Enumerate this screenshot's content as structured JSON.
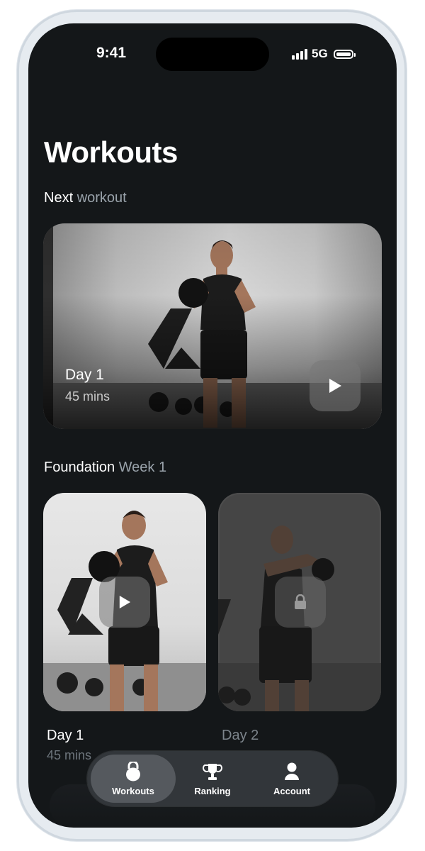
{
  "status_bar": {
    "time": "9:41",
    "network": "5G"
  },
  "page": {
    "title": "Workouts"
  },
  "next_workout": {
    "label": "Next",
    "label_muted": "workout",
    "card": {
      "title": "Day 1",
      "duration": "45 mins",
      "icon": "play-icon"
    }
  },
  "program": {
    "label": "Foundation",
    "label_muted": "Week 1",
    "days": [
      {
        "title": "Day 1",
        "duration": "45 mins",
        "icon": "play-icon",
        "locked": false
      },
      {
        "title": "Day 2",
        "icon": "lock-icon",
        "locked": true
      }
    ]
  },
  "tab_bar": {
    "items": [
      {
        "label": "Workouts",
        "icon": "kettlebell-icon",
        "active": true
      },
      {
        "label": "Ranking",
        "icon": "trophy-icon",
        "active": false
      },
      {
        "label": "Account",
        "icon": "person-icon",
        "active": false
      }
    ]
  },
  "colors": {
    "background": "#141719",
    "text_primary": "#ffffff",
    "text_muted": "#9aa3ab"
  }
}
